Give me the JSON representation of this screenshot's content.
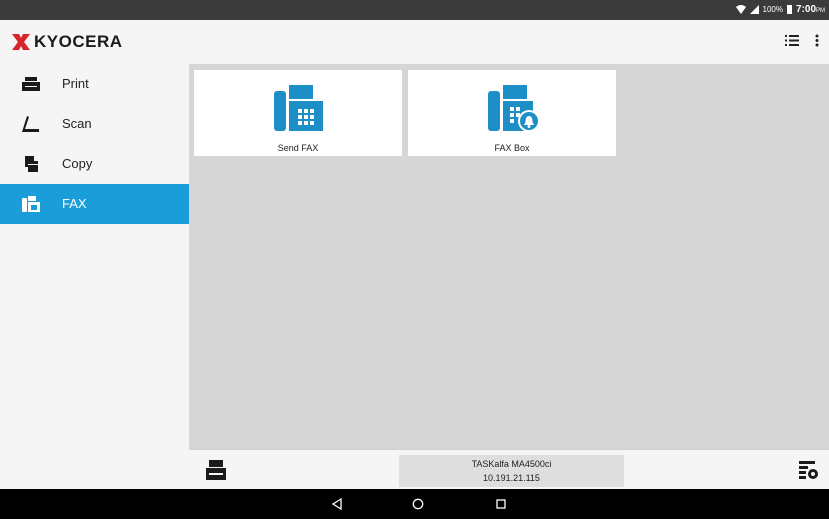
{
  "status": {
    "battery": "100%",
    "time": "7:00",
    "ampm": "PM"
  },
  "app": {
    "brand": "KYOCERA"
  },
  "sidebar": {
    "items": [
      {
        "label": "Print",
        "icon": "printer-icon",
        "active": false
      },
      {
        "label": "Scan",
        "icon": "scan-icon",
        "active": false
      },
      {
        "label": "Copy",
        "icon": "copy-icon",
        "active": false
      },
      {
        "label": "FAX",
        "icon": "fax-icon",
        "active": true
      }
    ]
  },
  "tiles": [
    {
      "label": "Send FAX",
      "icon": "fax-machine-icon"
    },
    {
      "label": "FAX Box",
      "icon": "fax-box-icon"
    }
  ],
  "device": {
    "name": "TASKalfa MA4500ci",
    "ip": "10.191.21.115"
  },
  "colors": {
    "accent": "#1a9dd9",
    "icon_blue": "#1e8fc6",
    "brand_red": "#d8232a"
  }
}
